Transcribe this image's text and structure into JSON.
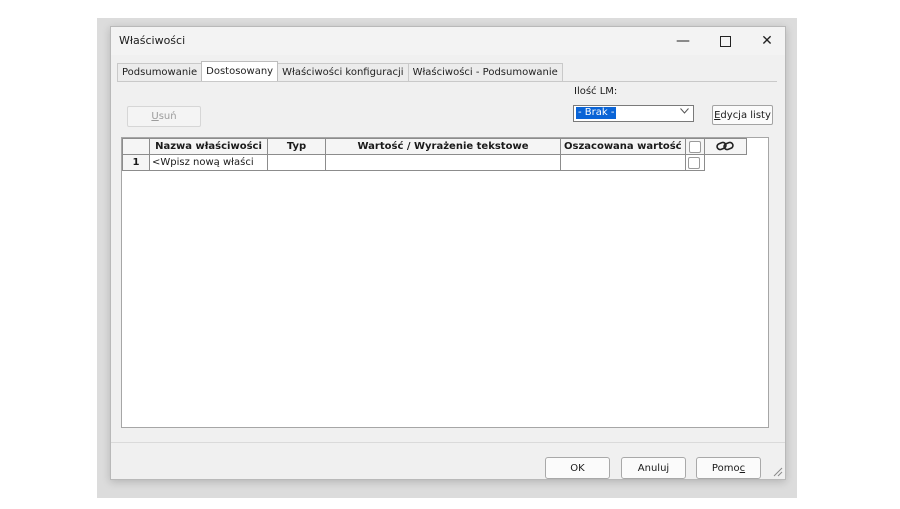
{
  "window": {
    "title": "Właściwości",
    "minimize_glyph": "—",
    "close_glyph": "✕"
  },
  "tabs": [
    {
      "label": "Podsumowanie",
      "active": false
    },
    {
      "label": "Dostosowany",
      "active": true
    },
    {
      "label": "Właściwości konfiguracji",
      "active": false
    },
    {
      "label": "Właściwości - Podsumowanie",
      "active": false
    }
  ],
  "toolbar": {
    "delete_underline": "U",
    "delete_rest": "suń",
    "bom_label": "Ilość LM:",
    "bom_value": "- Brak -",
    "edit_list_underline": "E",
    "edit_list_rest": "dycja listy"
  },
  "grid": {
    "columns": {
      "name": "Nazwa właściwości",
      "type": "Typ",
      "value": "Wartość / Wyrażenie tekstowe",
      "evaluated": "Oszacowana wartość"
    },
    "rows": [
      {
        "num": "1",
        "name": "<Wpisz nową właści",
        "type": "",
        "value": "",
        "evaluated": ""
      }
    ]
  },
  "buttons": {
    "ok": "OK",
    "cancel": "Anuluj",
    "help_main": "Pomo",
    "help_underline": "c"
  },
  "icons": {
    "link": "link-icon",
    "dropdown": "chevron-down-icon"
  }
}
